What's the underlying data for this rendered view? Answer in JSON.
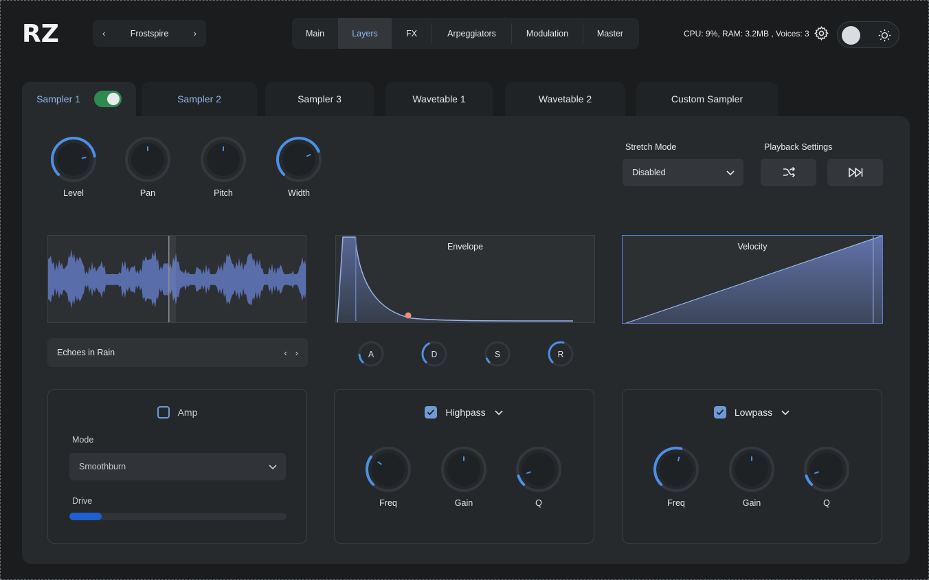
{
  "app": {
    "logo_text": "RZ",
    "preset": {
      "name": "Frostspire",
      "prev_icon": "chevron-left-icon",
      "next_icon": "chevron-right-icon"
    },
    "nav": [
      {
        "label": "Main",
        "active": false
      },
      {
        "label": "Layers",
        "active": true
      },
      {
        "label": "FX",
        "active": false
      },
      {
        "label": "Arpeggiators",
        "active": false
      },
      {
        "label": "Modulation",
        "active": false
      },
      {
        "label": "Master",
        "active": false
      }
    ],
    "status": "CPU: 9%, RAM: 3.2MB , Voices: 3",
    "settings_icon": "gear-icon",
    "theme_icon": "sun-icon"
  },
  "layers": {
    "tabs": [
      {
        "label": "Sampler 1",
        "active": true,
        "enabled": true
      },
      {
        "label": "Sampler 2",
        "active": false
      },
      {
        "label": "Sampler 3",
        "active": false
      },
      {
        "label": "Wavetable 1",
        "active": false
      },
      {
        "label": "Wavetable 2",
        "active": false
      },
      {
        "label": "Custom Sampler",
        "active": false
      }
    ]
  },
  "sampler": {
    "knobs": [
      {
        "label": "Level",
        "value": 0.8
      },
      {
        "label": "Pan",
        "value": 0.5
      },
      {
        "label": "Pitch",
        "value": 0.5
      },
      {
        "label": "Width",
        "value": 0.75
      }
    ],
    "stretch": {
      "label": "Stretch Mode",
      "value": "Disabled"
    },
    "playback": {
      "label": "Playback Settings",
      "shuffle_icon": "shuffle-icon",
      "forward_icon": "fast-forward-icon"
    },
    "sample_name": "Echoes in Rain",
    "envelope": {
      "title": "Envelope"
    },
    "velocity": {
      "title": "Velocity"
    },
    "adsr": [
      {
        "label": "A",
        "value": 0.15
      },
      {
        "label": "D",
        "value": 0.4
      },
      {
        "label": "S",
        "value": 0.08
      },
      {
        "label": "R",
        "value": 0.55
      }
    ]
  },
  "modules": {
    "amp": {
      "label": "Amp",
      "enabled": false,
      "mode_label": "Mode",
      "mode_value": "Smoothburn",
      "drive_label": "Drive",
      "drive_value": 0.15
    },
    "highpass": {
      "label": "Highpass",
      "enabled": true,
      "knobs": [
        {
          "label": "Freq",
          "value": 0.3
        },
        {
          "label": "Gain",
          "value": 0.5
        },
        {
          "label": "Q",
          "value": 0.1
        }
      ]
    },
    "lowpass": {
      "label": "Lowpass",
      "enabled": true,
      "knobs": [
        {
          "label": "Freq",
          "value": 0.55
        },
        {
          "label": "Gain",
          "value": 0.5
        },
        {
          "label": "Q",
          "value": 0.1
        }
      ]
    }
  },
  "colors": {
    "accent": "#4d8fe6",
    "accent_soft": "#8fb6e8",
    "toggle_on": "#2f8a4f",
    "wave": "#5f74b8",
    "marker": "#f08a7c"
  }
}
